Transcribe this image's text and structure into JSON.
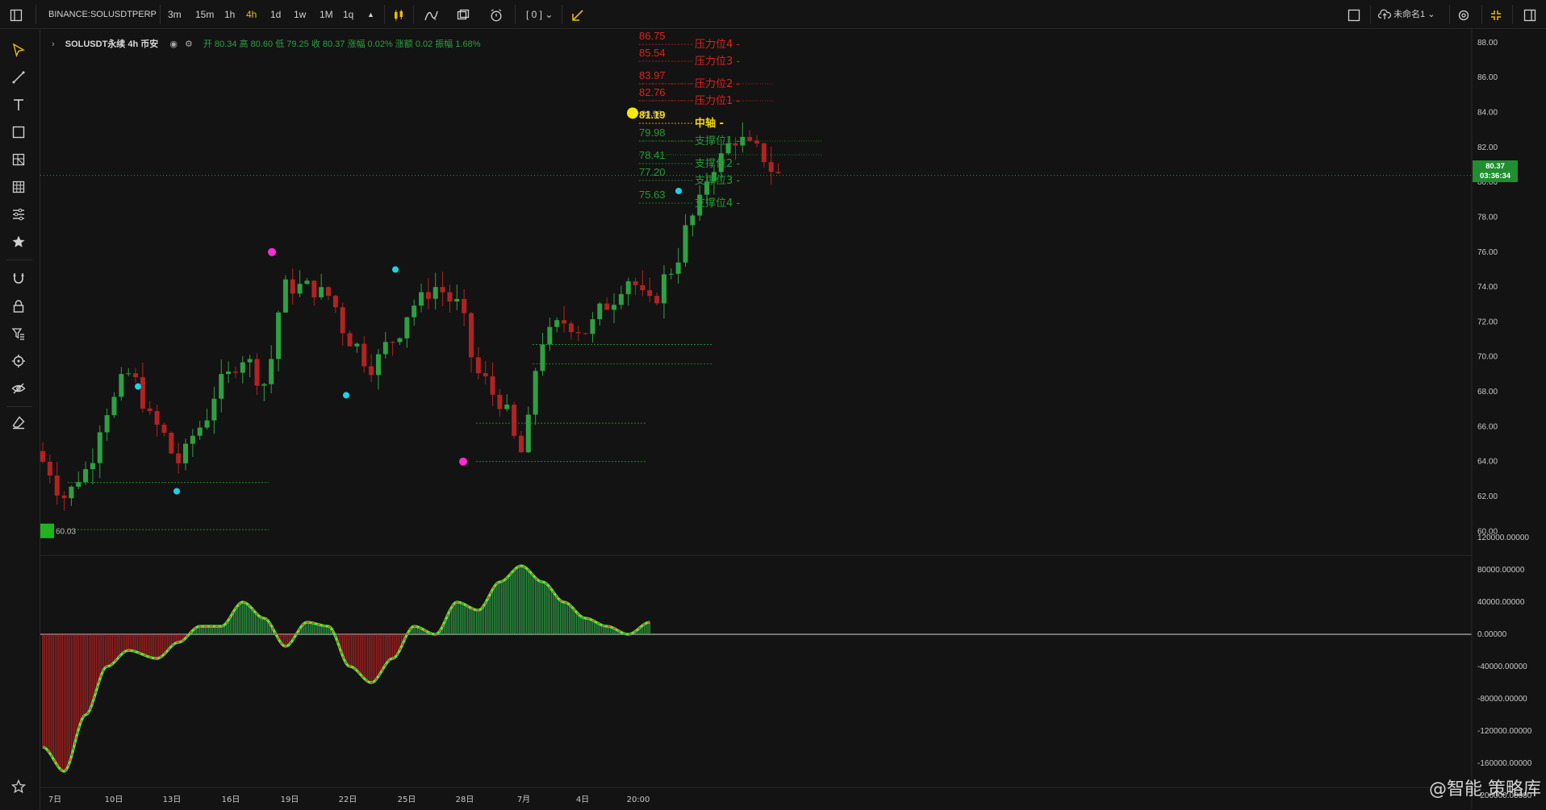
{
  "toolbar": {
    "symbol": "BINANCE:SOLUSDTPERP",
    "intervals": [
      "3m",
      "15m",
      "1h",
      "4h",
      "1d",
      "1w",
      "1M",
      "1q"
    ],
    "active_interval": "4h",
    "indicator_count": "[ 0 ]",
    "layout_name": "未命名1",
    "accent": "#f0b90b"
  },
  "legend": {
    "symbol_text": "SOLUSDT永续  4h  币安",
    "ohlc_text": "开 80.34  高 80.60  低 79.25  收 80.37  涨幅 0.02%  涨额 0.02  振幅 1.68%"
  },
  "price_badge": {
    "price": "80.37",
    "countdown": "03:36:34"
  },
  "markers": {
    "high_label": "83.96",
    "low_label": "60.03"
  },
  "levels": [
    {
      "name": "压力位4",
      "price": "86.75",
      "kind": "resistance"
    },
    {
      "name": "压力位3",
      "price": "85.54",
      "kind": "resistance"
    },
    {
      "name": "压力位2",
      "price": "83.97",
      "kind": "resistance"
    },
    {
      "name": "压力位1",
      "price": "82.76",
      "kind": "resistance"
    },
    {
      "name": "中轴",
      "price": "81.19",
      "kind": "pivot"
    },
    {
      "name": "支撑位1",
      "price": "79.98",
      "kind": "support"
    },
    {
      "name": "支撑位2",
      "price": "78.41",
      "kind": "support"
    },
    {
      "name": "支撑位3",
      "price": "77.20",
      "kind": "support"
    },
    {
      "name": "支撑位4",
      "price": "75.63",
      "kind": "support"
    }
  ],
  "price_axis": [
    "88.00",
    "86.00",
    "84.00",
    "82.00",
    "80.00",
    "78.00",
    "76.00",
    "74.00",
    "72.00",
    "70.00",
    "68.00",
    "66.00",
    "64.00",
    "62.00",
    "60.00"
  ],
  "osc_axis": [
    "120000.00000",
    "80000.00000",
    "40000.00000",
    "0.00000",
    "-40000.00000",
    "-80000.00000",
    "-120000.00000",
    "-160000.00000",
    "-200000.00000"
  ],
  "time_axis": [
    "7日",
    "10日",
    "13日",
    "16日",
    "19日",
    "22日",
    "25日",
    "28日",
    "7月",
    "4日",
    "20:00"
  ],
  "watermark": "@智能 策略库",
  "colors": {
    "up": "#2ea043",
    "down": "#b22222",
    "resistance": "#e0201e",
    "pivot": "#f5d90a",
    "support": "#1f9d2f",
    "background": "#131313"
  },
  "chart_data": {
    "type": "candlestick",
    "price_ylim": [
      59,
      88.5
    ],
    "close_anchors": [
      [
        0,
        64
      ],
      [
        3,
        62
      ],
      [
        6,
        63.5
      ],
      [
        9,
        67
      ],
      [
        12,
        69
      ],
      [
        16,
        66
      ],
      [
        19,
        64
      ],
      [
        22,
        66
      ],
      [
        25,
        68.5
      ],
      [
        28,
        70
      ],
      [
        31,
        68.5
      ],
      [
        34,
        74
      ],
      [
        37,
        74
      ],
      [
        40,
        73.5
      ],
      [
        43,
        71
      ],
      [
        46,
        69.5
      ],
      [
        49,
        71
      ],
      [
        52,
        73
      ],
      [
        55,
        74
      ],
      [
        58,
        73
      ],
      [
        61,
        69
      ],
      [
        64,
        67.5
      ],
      [
        67,
        64.5
      ],
      [
        70,
        71
      ],
      [
        73,
        72
      ],
      [
        76,
        71.5
      ],
      [
        79,
        73
      ],
      [
        82,
        74.5
      ],
      [
        85,
        73
      ],
      [
        88,
        75
      ],
      [
        91,
        78
      ],
      [
        94,
        81
      ],
      [
        97,
        82.5
      ],
      [
        100,
        81.8
      ],
      [
        103,
        80.4
      ]
    ],
    "oscillator_anchors": [
      [
        0,
        -140000
      ],
      [
        3,
        -170000
      ],
      [
        6,
        -100000
      ],
      [
        9,
        -40000
      ],
      [
        12,
        -20000
      ],
      [
        16,
        -30000
      ],
      [
        19,
        -10000
      ],
      [
        22,
        10000
      ],
      [
        25,
        10000
      ],
      [
        28,
        40000
      ],
      [
        31,
        20000
      ],
      [
        34,
        -15000
      ],
      [
        37,
        15000
      ],
      [
        40,
        10000
      ],
      [
        43,
        -40000
      ],
      [
        46,
        -60000
      ],
      [
        49,
        -30000
      ],
      [
        52,
        10000
      ],
      [
        55,
        0
      ],
      [
        58,
        40000
      ],
      [
        61,
        30000
      ],
      [
        64,
        65000
      ],
      [
        67,
        85000
      ],
      [
        70,
        65000
      ],
      [
        73,
        40000
      ],
      [
        76,
        20000
      ],
      [
        79,
        10000
      ],
      [
        82,
        0
      ],
      [
        85,
        15000
      ]
    ]
  }
}
